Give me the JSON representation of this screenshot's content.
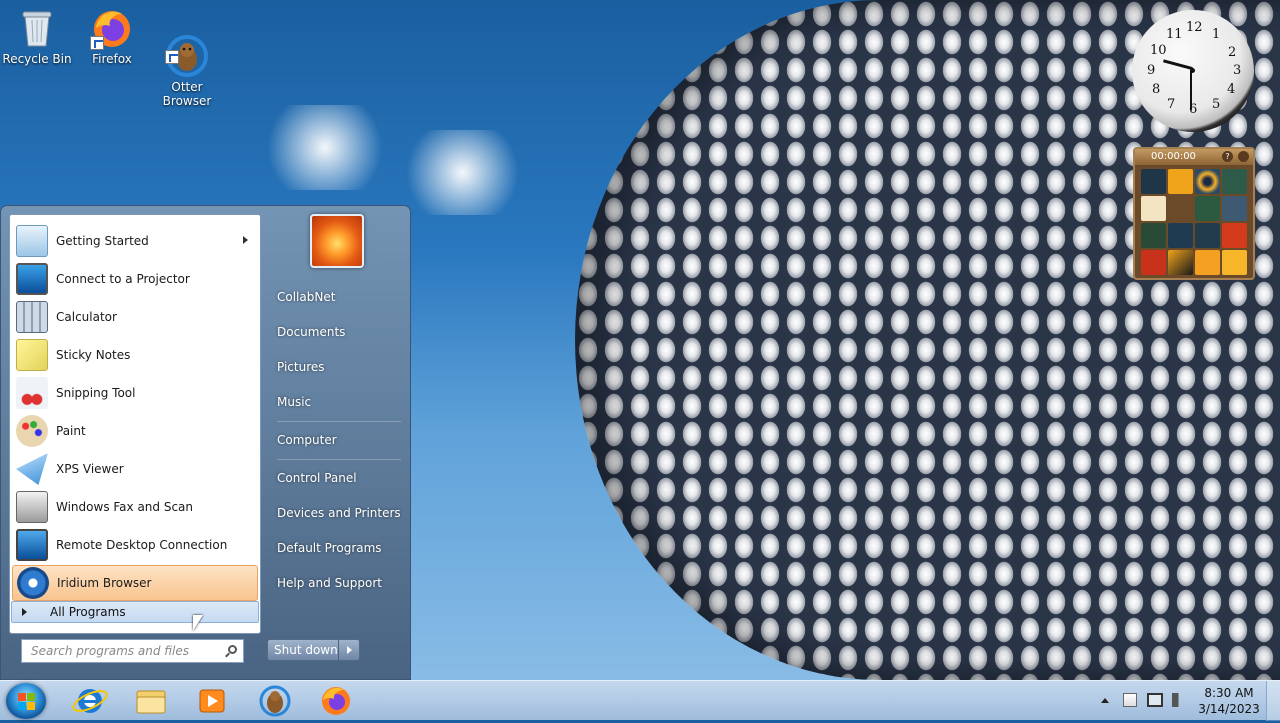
{
  "desktop": {
    "icons": [
      {
        "label": "Recycle Bin",
        "icon": "recycle-bin-icon"
      },
      {
        "label": "Firefox",
        "icon": "firefox-icon"
      },
      {
        "label": "Otter\nBrowser",
        "icon": "otter-browser-icon"
      }
    ]
  },
  "gadgets": {
    "clock": {
      "numbers": [
        "12",
        "1",
        "2",
        "3",
        "4",
        "5",
        "6",
        "7",
        "8",
        "9",
        "10",
        "11"
      ],
      "time": "8:30"
    },
    "puzzle": {
      "timer": "00:00:00"
    }
  },
  "start_menu": {
    "programs": [
      {
        "label": "Getting Started",
        "icon": "getting-started-icon",
        "submenu": true
      },
      {
        "label": "Connect to a Projector",
        "icon": "projector-icon"
      },
      {
        "label": "Calculator",
        "icon": "calculator-icon"
      },
      {
        "label": "Sticky Notes",
        "icon": "sticky-notes-icon"
      },
      {
        "label": "Snipping Tool",
        "icon": "scissors-icon"
      },
      {
        "label": "Paint",
        "icon": "paint-palette-icon"
      },
      {
        "label": "XPS Viewer",
        "icon": "xps-viewer-icon"
      },
      {
        "label": "Windows Fax and Scan",
        "icon": "fax-scanner-icon"
      },
      {
        "label": "Remote Desktop Connection",
        "icon": "remote-desktop-icon"
      },
      {
        "label": "Iridium Browser",
        "icon": "iridium-browser-icon",
        "highlighted": true
      }
    ],
    "all_programs": "All Programs",
    "search_placeholder": "Search programs and files",
    "right_items": [
      "CollabNet",
      "Documents",
      "Pictures",
      "Music",
      "Computer",
      "Control Panel",
      "Devices and Printers",
      "Default Programs",
      "Help and Support"
    ],
    "shutdown": "Shut down"
  },
  "taskbar": {
    "pinned": [
      "internet-explorer-icon",
      "file-explorer-icon",
      "media-player-icon",
      "otter-browser-icon",
      "firefox-icon"
    ],
    "clock_time": "8:30 AM",
    "clock_date": "3/14/2023"
  },
  "colors": {
    "highlight": "#f9c48f",
    "taskbar": "#a0bcdc",
    "accent": "#2e8fd6"
  }
}
